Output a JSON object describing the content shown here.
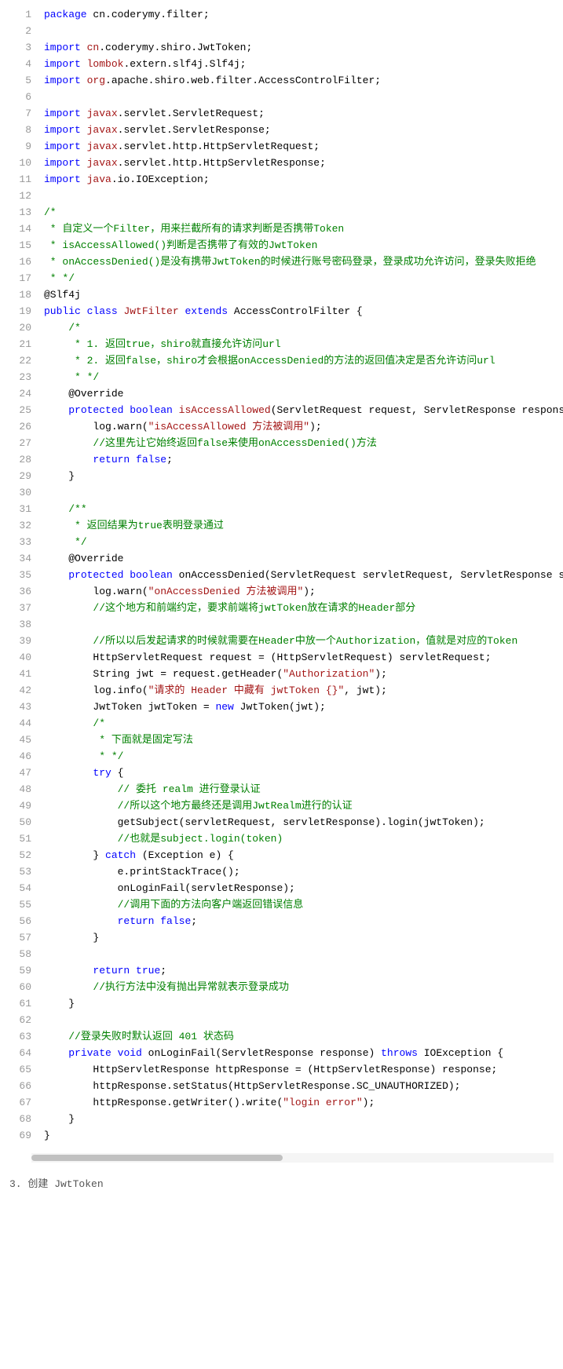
{
  "lines": [
    {
      "n": 1,
      "segs": [
        {
          "c": "kw",
          "t": "package"
        },
        {
          "c": "nm",
          "t": " cn.coderymy.filter;"
        }
      ]
    },
    {
      "n": 2,
      "segs": []
    },
    {
      "n": 3,
      "segs": [
        {
          "c": "kw",
          "t": "import"
        },
        {
          "c": "nm",
          "t": " "
        },
        {
          "c": "ns",
          "t": "cn"
        },
        {
          "c": "nm",
          "t": ".coderymy.shiro.JwtToken;"
        }
      ]
    },
    {
      "n": 4,
      "segs": [
        {
          "c": "kw",
          "t": "import"
        },
        {
          "c": "nm",
          "t": " "
        },
        {
          "c": "ns",
          "t": "lombok"
        },
        {
          "c": "nm",
          "t": ".extern.slf4j.Slf4j;"
        }
      ]
    },
    {
      "n": 5,
      "segs": [
        {
          "c": "kw",
          "t": "import"
        },
        {
          "c": "nm",
          "t": " "
        },
        {
          "c": "ns",
          "t": "org"
        },
        {
          "c": "nm",
          "t": ".apache.shiro.web.filter.AccessControlFilter;"
        }
      ]
    },
    {
      "n": 6,
      "segs": []
    },
    {
      "n": 7,
      "segs": [
        {
          "c": "kw",
          "t": "import"
        },
        {
          "c": "nm",
          "t": " "
        },
        {
          "c": "ns",
          "t": "javax"
        },
        {
          "c": "nm",
          "t": ".servlet.ServletRequest;"
        }
      ]
    },
    {
      "n": 8,
      "segs": [
        {
          "c": "kw",
          "t": "import"
        },
        {
          "c": "nm",
          "t": " "
        },
        {
          "c": "ns",
          "t": "javax"
        },
        {
          "c": "nm",
          "t": ".servlet.ServletResponse;"
        }
      ]
    },
    {
      "n": 9,
      "segs": [
        {
          "c": "kw",
          "t": "import"
        },
        {
          "c": "nm",
          "t": " "
        },
        {
          "c": "ns",
          "t": "javax"
        },
        {
          "c": "nm",
          "t": ".servlet.http.HttpServletRequest;"
        }
      ]
    },
    {
      "n": 10,
      "segs": [
        {
          "c": "kw",
          "t": "import"
        },
        {
          "c": "nm",
          "t": " "
        },
        {
          "c": "ns",
          "t": "javax"
        },
        {
          "c": "nm",
          "t": ".servlet.http.HttpServletResponse;"
        }
      ]
    },
    {
      "n": 11,
      "segs": [
        {
          "c": "kw",
          "t": "import"
        },
        {
          "c": "nm",
          "t": " "
        },
        {
          "c": "ns",
          "t": "java"
        },
        {
          "c": "nm",
          "t": ".io.IOException;"
        }
      ]
    },
    {
      "n": 12,
      "segs": []
    },
    {
      "n": 13,
      "segs": [
        {
          "c": "cmt",
          "t": "/*"
        }
      ]
    },
    {
      "n": 14,
      "segs": [
        {
          "c": "cmt",
          "t": " * 自定义一个Filter，用来拦截所有的请求判断是否携带Token"
        }
      ]
    },
    {
      "n": 15,
      "segs": [
        {
          "c": "cmt",
          "t": " * isAccessAllowed()判断是否携带了有效的JwtToken"
        }
      ]
    },
    {
      "n": 16,
      "segs": [
        {
          "c": "cmt",
          "t": " * onAccessDenied()是没有携带JwtToken的时候进行账号密码登录，登录成功允许访问，登录失败拒绝"
        }
      ]
    },
    {
      "n": 17,
      "segs": [
        {
          "c": "cmt",
          "t": " * */"
        }
      ]
    },
    {
      "n": 18,
      "segs": [
        {
          "c": "nm",
          "t": "@Slf4j"
        }
      ]
    },
    {
      "n": 19,
      "segs": [
        {
          "c": "kw",
          "t": "public"
        },
        {
          "c": "nm",
          "t": " "
        },
        {
          "c": "kw",
          "t": "class"
        },
        {
          "c": "nm",
          "t": " "
        },
        {
          "c": "cls",
          "t": "JwtFilter"
        },
        {
          "c": "nm",
          "t": " "
        },
        {
          "c": "kw",
          "t": "extends"
        },
        {
          "c": "nm",
          "t": " AccessControlFilter {"
        }
      ]
    },
    {
      "n": 20,
      "segs": [
        {
          "c": "nm",
          "t": "    "
        },
        {
          "c": "cmt",
          "t": "/*"
        }
      ]
    },
    {
      "n": 21,
      "segs": [
        {
          "c": "nm",
          "t": "    "
        },
        {
          "c": "cmt",
          "t": " * 1. 返回true，shiro就直接允许访问url"
        }
      ]
    },
    {
      "n": 22,
      "segs": [
        {
          "c": "nm",
          "t": "    "
        },
        {
          "c": "cmt",
          "t": " * 2. 返回false，shiro才会根据onAccessDenied的方法的返回值决定是否允许访问url"
        }
      ]
    },
    {
      "n": 23,
      "segs": [
        {
          "c": "nm",
          "t": "    "
        },
        {
          "c": "cmt",
          "t": " * */"
        }
      ]
    },
    {
      "n": 24,
      "segs": [
        {
          "c": "nm",
          "t": "    @Override"
        }
      ]
    },
    {
      "n": 25,
      "segs": [
        {
          "c": "nm",
          "t": "    "
        },
        {
          "c": "kw",
          "t": "protected"
        },
        {
          "c": "nm",
          "t": " "
        },
        {
          "c": "kw",
          "t": "boolean"
        },
        {
          "c": "nm",
          "t": " "
        },
        {
          "c": "mth",
          "t": "isAccessAllowed"
        },
        {
          "c": "nm",
          "t": "(ServletRequest request, ServletResponse response, Obje"
        }
      ]
    },
    {
      "n": 26,
      "segs": [
        {
          "c": "nm",
          "t": "        log.warn("
        },
        {
          "c": "str",
          "t": "\"isAccessAllowed 方法被调用\""
        },
        {
          "c": "nm",
          "t": ");"
        }
      ]
    },
    {
      "n": 27,
      "segs": [
        {
          "c": "nm",
          "t": "        "
        },
        {
          "c": "cmt",
          "t": "//这里先让它始终返回false来使用onAccessDenied()方法"
        }
      ]
    },
    {
      "n": 28,
      "segs": [
        {
          "c": "nm",
          "t": "        "
        },
        {
          "c": "kw",
          "t": "return"
        },
        {
          "c": "nm",
          "t": " "
        },
        {
          "c": "kw",
          "t": "false"
        },
        {
          "c": "nm",
          "t": ";"
        }
      ]
    },
    {
      "n": 29,
      "segs": [
        {
          "c": "nm",
          "t": "    }"
        }
      ]
    },
    {
      "n": 30,
      "segs": []
    },
    {
      "n": 31,
      "segs": [
        {
          "c": "nm",
          "t": "    "
        },
        {
          "c": "cmt",
          "t": "/**"
        }
      ]
    },
    {
      "n": 32,
      "segs": [
        {
          "c": "nm",
          "t": "    "
        },
        {
          "c": "cmt",
          "t": " * 返回结果为true表明登录通过"
        }
      ]
    },
    {
      "n": 33,
      "segs": [
        {
          "c": "nm",
          "t": "    "
        },
        {
          "c": "cmt",
          "t": " */"
        }
      ]
    },
    {
      "n": 34,
      "segs": [
        {
          "c": "nm",
          "t": "    @Override"
        }
      ]
    },
    {
      "n": 35,
      "segs": [
        {
          "c": "nm",
          "t": "    "
        },
        {
          "c": "kw",
          "t": "protected"
        },
        {
          "c": "nm",
          "t": " "
        },
        {
          "c": "kw",
          "t": "boolean"
        },
        {
          "c": "nm",
          "t": " onAccessDenied(ServletRequest servletRequest, ServletResponse servletR"
        }
      ]
    },
    {
      "n": 36,
      "segs": [
        {
          "c": "nm",
          "t": "        log.warn("
        },
        {
          "c": "str",
          "t": "\"onAccessDenied 方法被调用\""
        },
        {
          "c": "nm",
          "t": ");"
        }
      ]
    },
    {
      "n": 37,
      "segs": [
        {
          "c": "nm",
          "t": "        "
        },
        {
          "c": "cmt",
          "t": "//这个地方和前端约定，要求前端将jwtToken放在请求的Header部分"
        }
      ]
    },
    {
      "n": 38,
      "segs": []
    },
    {
      "n": 39,
      "segs": [
        {
          "c": "nm",
          "t": "        "
        },
        {
          "c": "cmt",
          "t": "//所以以后发起请求的时候就需要在Header中放一个Authorization，值就是对应的Token"
        }
      ]
    },
    {
      "n": 40,
      "segs": [
        {
          "c": "nm",
          "t": "        HttpServletRequest request = (HttpServletRequest) servletRequest;"
        }
      ]
    },
    {
      "n": 41,
      "segs": [
        {
          "c": "nm",
          "t": "        String jwt = request.getHeader("
        },
        {
          "c": "str",
          "t": "\"Authorization\""
        },
        {
          "c": "nm",
          "t": ");"
        }
      ]
    },
    {
      "n": 42,
      "segs": [
        {
          "c": "nm",
          "t": "        log.info("
        },
        {
          "c": "str",
          "t": "\"请求的 Header 中藏有 jwtToken {}\""
        },
        {
          "c": "nm",
          "t": ", jwt);"
        }
      ]
    },
    {
      "n": 43,
      "segs": [
        {
          "c": "nm",
          "t": "        JwtToken jwtToken = "
        },
        {
          "c": "kw",
          "t": "new"
        },
        {
          "c": "nm",
          "t": " JwtToken(jwt);"
        }
      ]
    },
    {
      "n": 44,
      "segs": [
        {
          "c": "nm",
          "t": "        "
        },
        {
          "c": "cmt",
          "t": "/*"
        }
      ]
    },
    {
      "n": 45,
      "segs": [
        {
          "c": "nm",
          "t": "        "
        },
        {
          "c": "cmt",
          "t": " * 下面就是固定写法"
        }
      ]
    },
    {
      "n": 46,
      "segs": [
        {
          "c": "nm",
          "t": "        "
        },
        {
          "c": "cmt",
          "t": " * */"
        }
      ]
    },
    {
      "n": 47,
      "segs": [
        {
          "c": "nm",
          "t": "        "
        },
        {
          "c": "kw",
          "t": "try"
        },
        {
          "c": "nm",
          "t": " {"
        }
      ]
    },
    {
      "n": 48,
      "segs": [
        {
          "c": "nm",
          "t": "            "
        },
        {
          "c": "cmt",
          "t": "// 委托 realm 进行登录认证"
        }
      ]
    },
    {
      "n": 49,
      "segs": [
        {
          "c": "nm",
          "t": "            "
        },
        {
          "c": "cmt",
          "t": "//所以这个地方最终还是调用JwtRealm进行的认证"
        }
      ]
    },
    {
      "n": 50,
      "segs": [
        {
          "c": "nm",
          "t": "            getSubject(servletRequest, servletResponse).login(jwtToken);"
        }
      ]
    },
    {
      "n": 51,
      "segs": [
        {
          "c": "nm",
          "t": "            "
        },
        {
          "c": "cmt",
          "t": "//也就是subject.login(token)"
        }
      ]
    },
    {
      "n": 52,
      "segs": [
        {
          "c": "nm",
          "t": "        } "
        },
        {
          "c": "kw",
          "t": "catch"
        },
        {
          "c": "nm",
          "t": " (Exception e) {"
        }
      ]
    },
    {
      "n": 53,
      "segs": [
        {
          "c": "nm",
          "t": "            e.printStackTrace();"
        }
      ]
    },
    {
      "n": 54,
      "segs": [
        {
          "c": "nm",
          "t": "            onLoginFail(servletResponse);"
        }
      ]
    },
    {
      "n": 55,
      "segs": [
        {
          "c": "nm",
          "t": "            "
        },
        {
          "c": "cmt",
          "t": "//调用下面的方法向客户端返回错误信息"
        }
      ]
    },
    {
      "n": 56,
      "segs": [
        {
          "c": "nm",
          "t": "            "
        },
        {
          "c": "kw",
          "t": "return"
        },
        {
          "c": "nm",
          "t": " "
        },
        {
          "c": "kw",
          "t": "false"
        },
        {
          "c": "nm",
          "t": ";"
        }
      ]
    },
    {
      "n": 57,
      "segs": [
        {
          "c": "nm",
          "t": "        }"
        }
      ]
    },
    {
      "n": 58,
      "segs": []
    },
    {
      "n": 59,
      "segs": [
        {
          "c": "nm",
          "t": "        "
        },
        {
          "c": "kw",
          "t": "return"
        },
        {
          "c": "nm",
          "t": " "
        },
        {
          "c": "kw",
          "t": "true"
        },
        {
          "c": "nm",
          "t": ";"
        }
      ]
    },
    {
      "n": 60,
      "segs": [
        {
          "c": "nm",
          "t": "        "
        },
        {
          "c": "cmt",
          "t": "//执行方法中没有抛出异常就表示登录成功"
        }
      ]
    },
    {
      "n": 61,
      "segs": [
        {
          "c": "nm",
          "t": "    }"
        }
      ]
    },
    {
      "n": 62,
      "segs": []
    },
    {
      "n": 63,
      "segs": [
        {
          "c": "nm",
          "t": "    "
        },
        {
          "c": "cmt",
          "t": "//登录失败时默认返回 401 状态码"
        }
      ]
    },
    {
      "n": 64,
      "segs": [
        {
          "c": "nm",
          "t": "    "
        },
        {
          "c": "kw",
          "t": "private"
        },
        {
          "c": "nm",
          "t": " "
        },
        {
          "c": "kw",
          "t": "void"
        },
        {
          "c": "nm",
          "t": " onLoginFail(ServletResponse response) "
        },
        {
          "c": "kw",
          "t": "throws"
        },
        {
          "c": "nm",
          "t": " IOException {"
        }
      ]
    },
    {
      "n": 65,
      "segs": [
        {
          "c": "nm",
          "t": "        HttpServletResponse httpResponse = (HttpServletResponse) response;"
        }
      ]
    },
    {
      "n": 66,
      "segs": [
        {
          "c": "nm",
          "t": "        httpResponse.setStatus(HttpServletResponse.SC_UNAUTHORIZED);"
        }
      ]
    },
    {
      "n": 67,
      "segs": [
        {
          "c": "nm",
          "t": "        httpResponse.getWriter().write("
        },
        {
          "c": "str",
          "t": "\"login error\""
        },
        {
          "c": "nm",
          "t": ");"
        }
      ]
    },
    {
      "n": 68,
      "segs": [
        {
          "c": "nm",
          "t": "    }"
        }
      ]
    },
    {
      "n": 69,
      "segs": [
        {
          "c": "nm",
          "t": "}"
        }
      ]
    }
  ],
  "footer": "3. 创建 JwtToken"
}
